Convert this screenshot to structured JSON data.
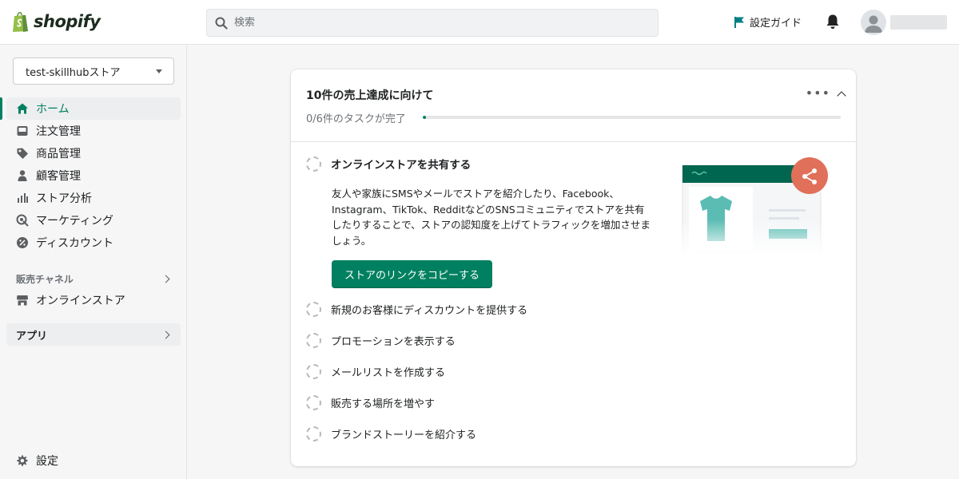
{
  "header": {
    "logo_text": "shopify",
    "search_placeholder": "検索",
    "setup_guide_label": "設定ガイド",
    "accent_color": "#008060"
  },
  "sidebar": {
    "store_name": "test-skillhubストア",
    "items": [
      {
        "label": "ホーム",
        "icon": "home-icon",
        "active": true
      },
      {
        "label": "注文管理",
        "icon": "inbox-icon",
        "active": false
      },
      {
        "label": "商品管理",
        "icon": "tag-icon",
        "active": false
      },
      {
        "label": "顧客管理",
        "icon": "person-icon",
        "active": false
      },
      {
        "label": "ストア分析",
        "icon": "bar-chart-icon",
        "active": false
      },
      {
        "label": "マーケティング",
        "icon": "target-icon",
        "active": false
      },
      {
        "label": "ディスカウント",
        "icon": "discount-icon",
        "active": false
      }
    ],
    "sales_channels_label": "販売チャネル",
    "online_store_label": "オンラインストア",
    "apps_label": "アプリ",
    "settings_label": "設定"
  },
  "card": {
    "title": "10件の売上達成に向けて",
    "progress_text": "0/6件のタスクが完了",
    "progress_fraction": 0.0,
    "expanded_task": {
      "label": "オンラインストアを共有する",
      "description": "友人や家族にSMSやメールでストアを紹介したり、Facebook、Instagram、TikTok、RedditなどのSNSコミュニティでストアを共有したりすることで、ストアの認知度を上げてトラフィックを増加させましょう。",
      "button_label": "ストアのリンクをコピーする"
    },
    "tasks": [
      {
        "label": "新規のお客様にディスカウントを提供する"
      },
      {
        "label": "プロモーションを表示する"
      },
      {
        "label": "メールリストを作成する"
      },
      {
        "label": "販売する場所を増やす"
      },
      {
        "label": "ブランドストーリーを紹介する"
      }
    ]
  }
}
